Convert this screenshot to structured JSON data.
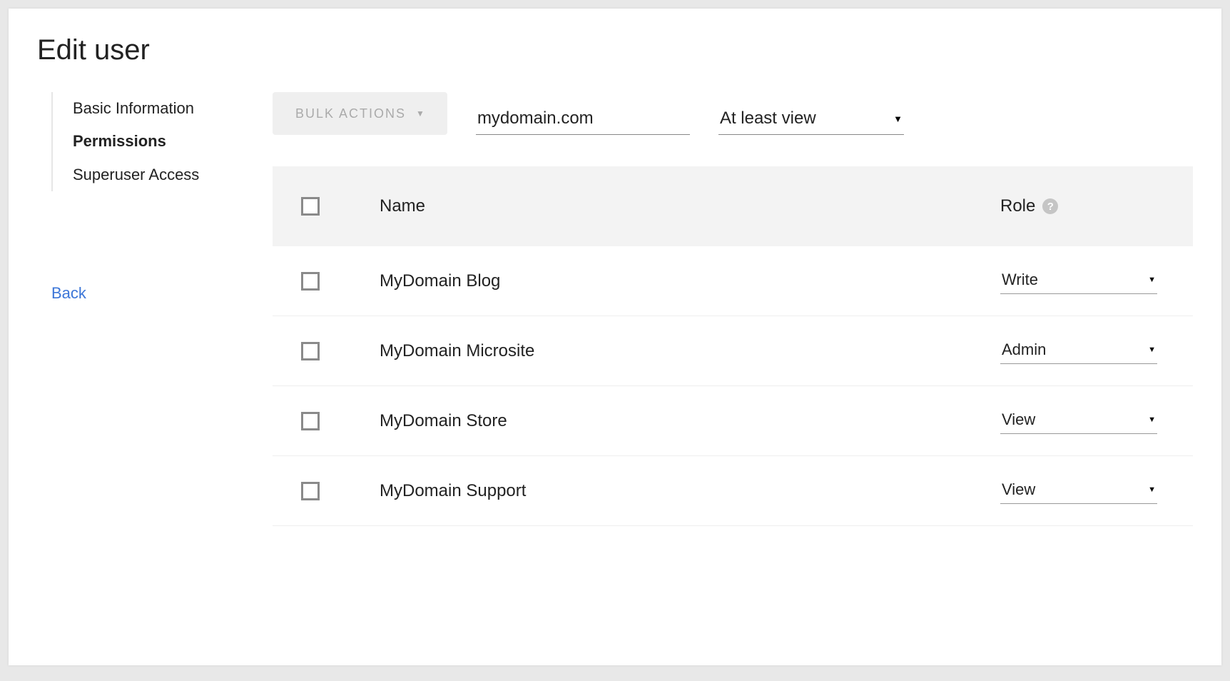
{
  "page": {
    "title": "Edit user"
  },
  "sidebar": {
    "items": [
      {
        "label": "Basic Information",
        "active": false
      },
      {
        "label": "Permissions",
        "active": true
      },
      {
        "label": "Superuser Access",
        "active": false
      }
    ],
    "back_label": "Back"
  },
  "toolbar": {
    "bulk_actions_label": "BULK ACTIONS",
    "domain_filter_value": "mydomain.com",
    "role_filter_value": "At least view"
  },
  "table": {
    "columns": {
      "name": "Name",
      "role": "Role"
    },
    "help_glyph": "?",
    "rows": [
      {
        "name": "MyDomain Blog",
        "role": "Write"
      },
      {
        "name": "MyDomain Microsite",
        "role": "Admin"
      },
      {
        "name": "MyDomain Store",
        "role": "View"
      },
      {
        "name": "MyDomain Support",
        "role": "View"
      }
    ]
  }
}
